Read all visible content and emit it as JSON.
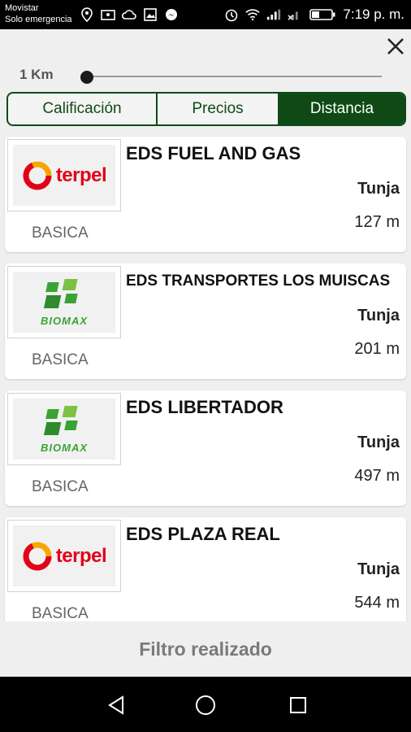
{
  "status_bar": {
    "carrier": "Movistar",
    "carrier_sub": "Solo emergencia",
    "time": "7:19 p. m."
  },
  "filter": {
    "radius_label": "1 Km",
    "tabs": [
      {
        "label": "Calificación",
        "active": false
      },
      {
        "label": "Precios",
        "active": false
      },
      {
        "label": "Distancia",
        "active": true
      }
    ]
  },
  "stations": [
    {
      "name": "EDS FUEL AND GAS",
      "city": "Tunja",
      "distance": "127 m",
      "category": "BASICA",
      "brand": "terpel"
    },
    {
      "name": "EDS TRANSPORTES LOS MUISCAS",
      "city": "Tunja",
      "distance": "201 m",
      "category": "BASICA",
      "brand": "BIOMAX"
    },
    {
      "name": "EDS LIBERTADOR",
      "city": "Tunja",
      "distance": "497 m",
      "category": "BASICA",
      "brand": "BIOMAX"
    },
    {
      "name": "EDS PLAZA REAL",
      "city": "Tunja",
      "distance": "544 m",
      "category": "BASICA",
      "brand": "terpel"
    }
  ],
  "footer": {
    "message": "Filtro realizado"
  },
  "colors": {
    "accent": "#0f4a16",
    "terpel": "#e2001a",
    "biomax": "#3aa335"
  }
}
